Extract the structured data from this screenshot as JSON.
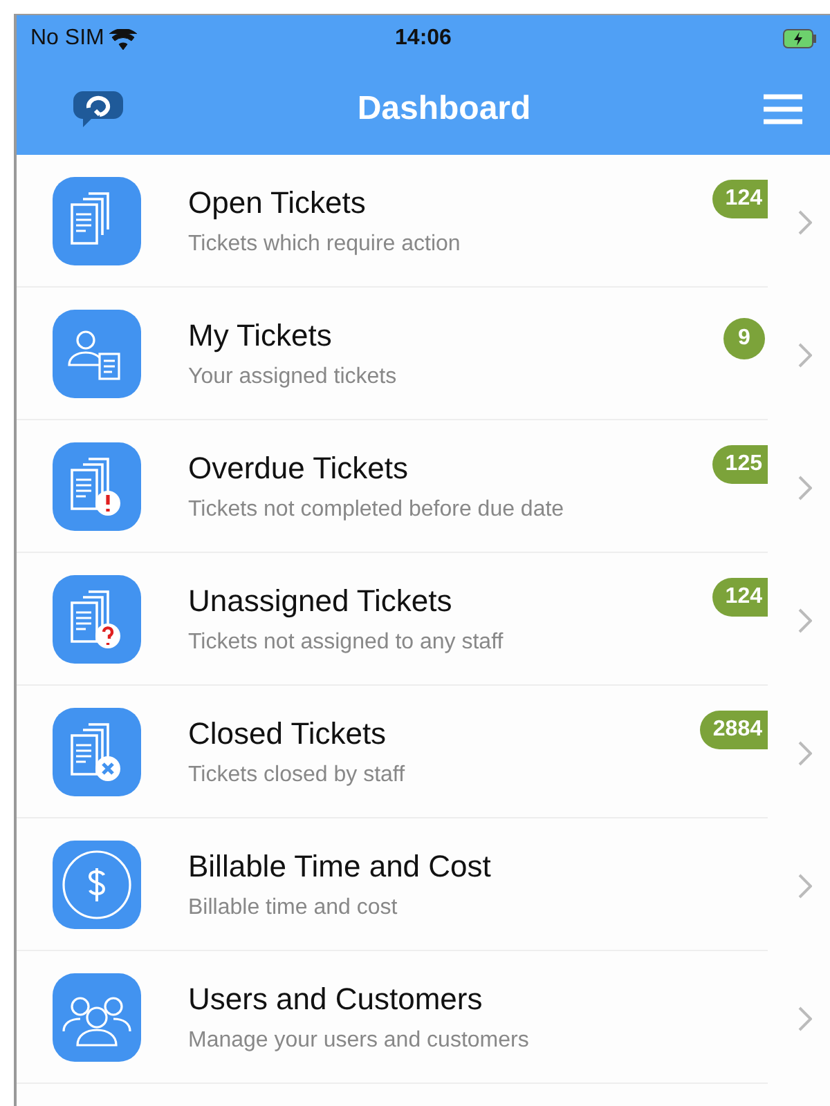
{
  "status_bar": {
    "carrier": "No SIM",
    "time": "14:06"
  },
  "header": {
    "title": "Dashboard"
  },
  "items": [
    {
      "kind": "docs",
      "title": "Open Tickets",
      "subtitle": "Tickets which require action",
      "count": "124"
    },
    {
      "kind": "user-doc",
      "title": "My Tickets",
      "subtitle": "Your assigned tickets",
      "count": "9"
    },
    {
      "kind": "docs-alert",
      "title": "Overdue Tickets",
      "subtitle": "Tickets not completed before due date",
      "count": "125"
    },
    {
      "kind": "docs-question",
      "title": "Unassigned Tickets",
      "subtitle": "Tickets not assigned to any staff",
      "count": "124"
    },
    {
      "kind": "docs-close",
      "title": "Closed Tickets",
      "subtitle": "Tickets closed by staff",
      "count": "2884"
    },
    {
      "kind": "dollar",
      "title": "Billable Time and Cost",
      "subtitle": "Billable time and cost"
    },
    {
      "kind": "users",
      "title": "Users and Customers",
      "subtitle": "Manage your users and customers"
    }
  ]
}
